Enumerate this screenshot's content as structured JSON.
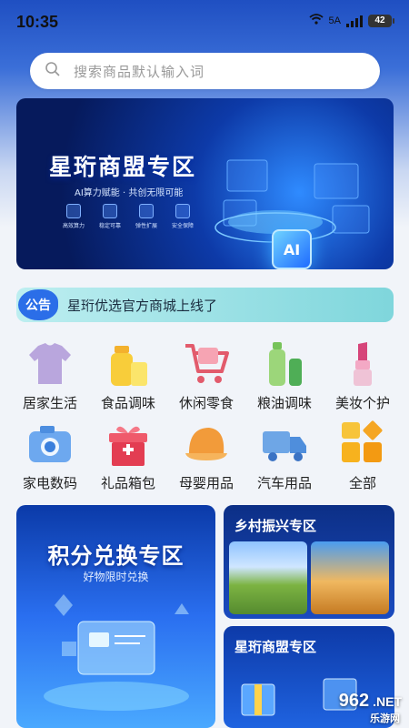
{
  "status_bar": {
    "time": "10:35",
    "network": "5A",
    "battery": "42"
  },
  "search": {
    "placeholder": "搜索商品默认输入词"
  },
  "banner": {
    "title": "星珩商盟专区",
    "subtitle": "AI算力赋能 · 共创无限可能",
    "features": [
      "高效算力",
      "稳定可靠",
      "弹性扩展",
      "安全保障"
    ],
    "chip_label": "AI"
  },
  "notice": {
    "tag": "公告",
    "text": "星珩优选官方商城上线了"
  },
  "categories": [
    {
      "label": "居家生活",
      "icon": "tshirt-icon"
    },
    {
      "label": "食品调味",
      "icon": "bottle-icon"
    },
    {
      "label": "休闲零食",
      "icon": "cart-icon"
    },
    {
      "label": "粮油调味",
      "icon": "oil-bottle-icon"
    },
    {
      "label": "美妆个护",
      "icon": "lipstick-icon"
    },
    {
      "label": "家电数码",
      "icon": "camera-icon"
    },
    {
      "label": "礼品箱包",
      "icon": "gift-icon"
    },
    {
      "label": "母婴用品",
      "icon": "cap-icon"
    },
    {
      "label": "汽车用品",
      "icon": "truck-icon"
    },
    {
      "label": "全部",
      "icon": "grid-icon"
    }
  ],
  "promo": {
    "points": {
      "title": "积分兑换专区",
      "subtitle": "好物限时兑换"
    },
    "rural": {
      "title": "乡村振兴专区"
    },
    "mall": {
      "title": "星珩商盟专区"
    }
  },
  "watermark": {
    "brand": "962",
    "suffix": ".NET",
    "sub": "乐游网"
  },
  "colors": {
    "accent": "#2b6ee8",
    "notice_bg": "#7fd6dc"
  }
}
